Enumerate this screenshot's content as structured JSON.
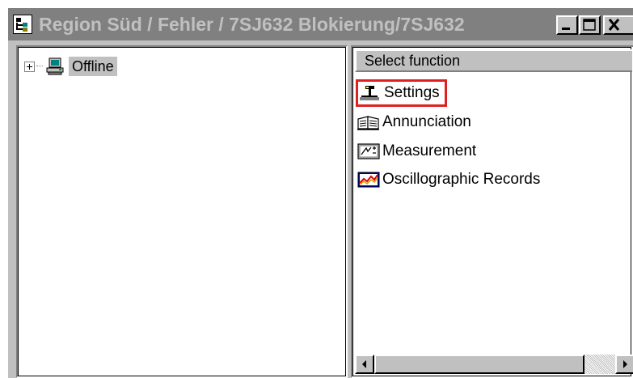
{
  "window": {
    "title": "Region Süd / Fehler / 7SJ632 Blokierung/7SJ632"
  },
  "tree": {
    "items": [
      {
        "label": "Offline",
        "icon": "offline-computer-icon",
        "expanded": false
      }
    ]
  },
  "function_list": {
    "header": "Select function",
    "items": [
      {
        "label": "Settings",
        "icon": "settings-icon",
        "highlighted": true
      },
      {
        "label": "Annunciation",
        "icon": "annunciation-icon"
      },
      {
        "label": "Measurement",
        "icon": "measurement-icon"
      },
      {
        "label": "Oscillographic Records",
        "icon": "oscillographic-icon"
      }
    ]
  },
  "colors": {
    "titlebar_inactive": "#808080",
    "highlight_box": "#e02020",
    "face": "#c0c0c0"
  }
}
